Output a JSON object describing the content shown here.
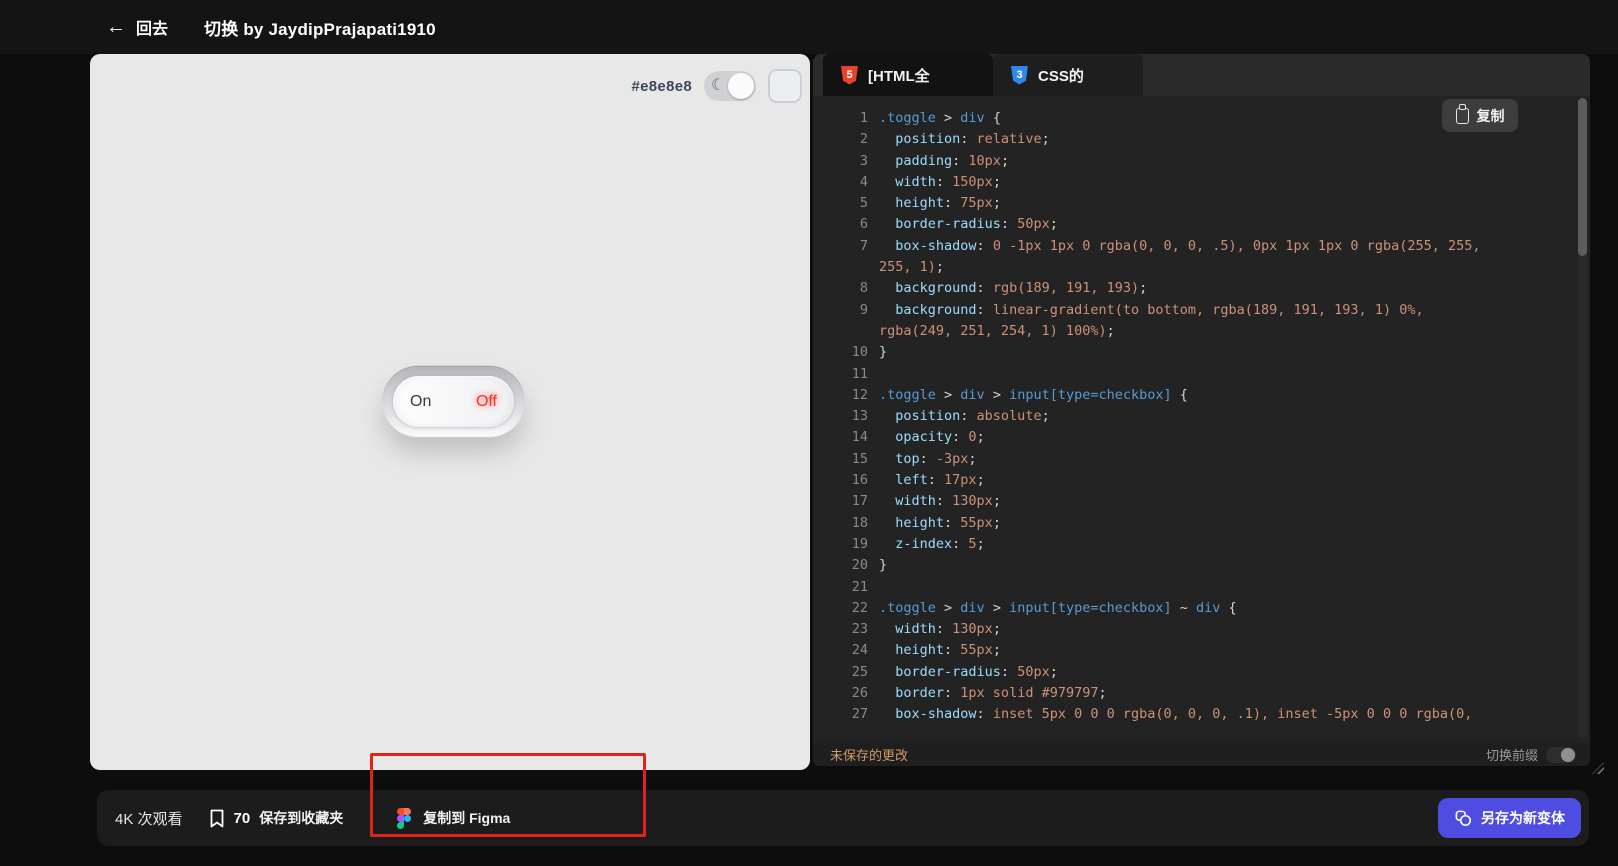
{
  "topbar": {
    "back_label": "回去",
    "title": "切换 by JaydipPrajapati1910"
  },
  "preview": {
    "bg_label": "#e8e8e8",
    "toggle_component": {
      "on": "On",
      "off": "Off"
    }
  },
  "code": {
    "tabs": [
      {
        "label": "[HTML全",
        "icon": "html5-icon",
        "icon_glyph": "5",
        "active": false
      },
      {
        "label": "CSS的",
        "icon": "css3-icon",
        "icon_glyph": "3",
        "active": true
      }
    ],
    "copy_label": "复制",
    "unsaved": "未保存的更改",
    "prefix_label": "切换前缀",
    "lines": [
      {
        "n": "1",
        "s": [
          [
            "sel",
            ".toggle"
          ],
          [
            "pun",
            " > "
          ],
          [
            "sel",
            "div"
          ],
          [
            "pun",
            " {"
          ]
        ]
      },
      {
        "n": "2",
        "s": [
          [
            "prop",
            "  position"
          ],
          [
            "pun",
            ": "
          ],
          [
            "val",
            "relative"
          ],
          [
            "pun",
            ";"
          ]
        ]
      },
      {
        "n": "3",
        "s": [
          [
            "prop",
            "  padding"
          ],
          [
            "pun",
            ": "
          ],
          [
            "val",
            "10px"
          ],
          [
            "pun",
            ";"
          ]
        ]
      },
      {
        "n": "4",
        "s": [
          [
            "prop",
            "  width"
          ],
          [
            "pun",
            ": "
          ],
          [
            "val",
            "150px"
          ],
          [
            "pun",
            ";"
          ]
        ]
      },
      {
        "n": "5",
        "s": [
          [
            "prop",
            "  height"
          ],
          [
            "pun",
            ": "
          ],
          [
            "val",
            "75px"
          ],
          [
            "pun",
            ";"
          ]
        ]
      },
      {
        "n": "6",
        "s": [
          [
            "prop",
            "  border-radius"
          ],
          [
            "pun",
            ": "
          ],
          [
            "val",
            "50px"
          ],
          [
            "pun",
            ";"
          ]
        ]
      },
      {
        "n": "7",
        "s": [
          [
            "prop",
            "  box-shadow"
          ],
          [
            "pun",
            ": "
          ],
          [
            "val",
            "0 -1px 1px 0 rgba(0, 0, 0, .5), 0px 1px 1px 0 rgba(255, 255,"
          ]
        ]
      },
      {
        "n": "",
        "s": [
          [
            "val",
            "255, 1)"
          ],
          [
            "pun",
            ";"
          ]
        ]
      },
      {
        "n": "8",
        "s": [
          [
            "prop",
            "  background"
          ],
          [
            "pun",
            ": "
          ],
          [
            "val",
            "rgb(189, 191, 193)"
          ],
          [
            "pun",
            ";"
          ]
        ]
      },
      {
        "n": "9",
        "s": [
          [
            "prop",
            "  background"
          ],
          [
            "pun",
            ": "
          ],
          [
            "val",
            "linear-gradient(to bottom, rgba(189, 191, 193, 1) 0%,"
          ]
        ]
      },
      {
        "n": "",
        "s": [
          [
            "val",
            "rgba(249, 251, 254, 1) 100%)"
          ],
          [
            "pun",
            ";"
          ]
        ]
      },
      {
        "n": "10",
        "s": [
          [
            "pun",
            "}"
          ]
        ]
      },
      {
        "n": "11",
        "s": []
      },
      {
        "n": "12",
        "s": [
          [
            "sel",
            ".toggle"
          ],
          [
            "pun",
            " > "
          ],
          [
            "sel",
            "div"
          ],
          [
            "pun",
            " > "
          ],
          [
            "sel",
            "input[type=checkbox]"
          ],
          [
            "pun",
            " {"
          ]
        ]
      },
      {
        "n": "13",
        "s": [
          [
            "prop",
            "  position"
          ],
          [
            "pun",
            ": "
          ],
          [
            "val",
            "absolute"
          ],
          [
            "pun",
            ";"
          ]
        ]
      },
      {
        "n": "14",
        "s": [
          [
            "prop",
            "  opacity"
          ],
          [
            "pun",
            ": "
          ],
          [
            "val",
            "0"
          ],
          [
            "pun",
            ";"
          ]
        ]
      },
      {
        "n": "15",
        "s": [
          [
            "prop",
            "  top"
          ],
          [
            "pun",
            ": "
          ],
          [
            "val",
            "-3px"
          ],
          [
            "pun",
            ";"
          ]
        ]
      },
      {
        "n": "16",
        "s": [
          [
            "prop",
            "  left"
          ],
          [
            "pun",
            ": "
          ],
          [
            "val",
            "17px"
          ],
          [
            "pun",
            ";"
          ]
        ]
      },
      {
        "n": "17",
        "s": [
          [
            "prop",
            "  width"
          ],
          [
            "pun",
            ": "
          ],
          [
            "val",
            "130px"
          ],
          [
            "pun",
            ";"
          ]
        ]
      },
      {
        "n": "18",
        "s": [
          [
            "prop",
            "  height"
          ],
          [
            "pun",
            ": "
          ],
          [
            "val",
            "55px"
          ],
          [
            "pun",
            ";"
          ]
        ]
      },
      {
        "n": "19",
        "s": [
          [
            "prop",
            "  z-index"
          ],
          [
            "pun",
            ": "
          ],
          [
            "val",
            "5"
          ],
          [
            "pun",
            ";"
          ]
        ]
      },
      {
        "n": "20",
        "s": [
          [
            "pun",
            "}"
          ]
        ]
      },
      {
        "n": "21",
        "s": []
      },
      {
        "n": "22",
        "s": [
          [
            "sel",
            ".toggle"
          ],
          [
            "pun",
            " > "
          ],
          [
            "sel",
            "div"
          ],
          [
            "pun",
            " > "
          ],
          [
            "sel",
            "input[type=checkbox]"
          ],
          [
            "pun",
            " ~ "
          ],
          [
            "sel",
            "div"
          ],
          [
            "pun",
            " {"
          ]
        ]
      },
      {
        "n": "23",
        "s": [
          [
            "prop",
            "  width"
          ],
          [
            "pun",
            ": "
          ],
          [
            "val",
            "130px"
          ],
          [
            "pun",
            ";"
          ]
        ]
      },
      {
        "n": "24",
        "s": [
          [
            "prop",
            "  height"
          ],
          [
            "pun",
            ": "
          ],
          [
            "val",
            "55px"
          ],
          [
            "pun",
            ";"
          ]
        ]
      },
      {
        "n": "25",
        "s": [
          [
            "prop",
            "  border-radius"
          ],
          [
            "pun",
            ": "
          ],
          [
            "val",
            "50px"
          ],
          [
            "pun",
            ";"
          ]
        ]
      },
      {
        "n": "26",
        "s": [
          [
            "prop",
            "  border"
          ],
          [
            "pun",
            ": "
          ],
          [
            "val",
            "1px solid #979797"
          ],
          [
            "pun",
            ";"
          ]
        ]
      },
      {
        "n": "27",
        "s": [
          [
            "prop",
            "  box-shadow"
          ],
          [
            "pun",
            ": "
          ],
          [
            "val",
            "inset 5px 0 0 0 rgba(0, 0, 0, .1), inset -5px 0 0 0 rgba(0,"
          ]
        ]
      }
    ]
  },
  "bottom": {
    "views": "4K 次观看",
    "bookmark_count": "70",
    "save_label": "保存到收藏夹",
    "figma_label": "复制到 Figma",
    "variant_label": "另存为新变体"
  },
  "colors": {
    "preview_bg": "#e8e8e8",
    "accent_button": "#4f4ce2",
    "annotation_red": "#e0241d",
    "unsaved_orange": "#d19a66",
    "off_label_red": "#ff2f28"
  }
}
